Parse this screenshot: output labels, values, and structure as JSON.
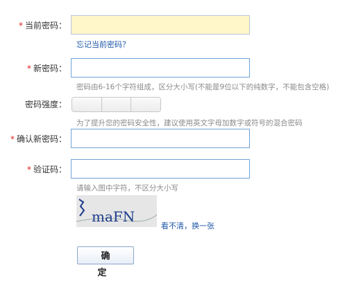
{
  "form": {
    "required_mark": "*",
    "current_password": {
      "label": "当前密码：",
      "value": "",
      "forgot_link": "忘记当前密码？"
    },
    "new_password": {
      "label": "新密码：",
      "value": "",
      "hint": "密码由6-16个字符组成，区分大小写(不能是9位以下的纯数字，不能包含空格)"
    },
    "strength": {
      "label": "密码强度：",
      "level": 0,
      "hint": "为了提升您的密码安全性，建议使用英文字母加数字或符号的混合密码"
    },
    "confirm_password": {
      "label": "确认新密码：",
      "value": ""
    },
    "captcha": {
      "label": "验证码：",
      "value": "",
      "hint": "请输入图中字符，不区分大小写",
      "image_text": "maFN",
      "refresh_link": "看不清，换一张"
    },
    "submit_label": "确 定"
  },
  "colors": {
    "required": "#e02020",
    "link": "#1f58a8",
    "input_border": "#6fa3d6",
    "focused_bg": "#fff6c9"
  }
}
